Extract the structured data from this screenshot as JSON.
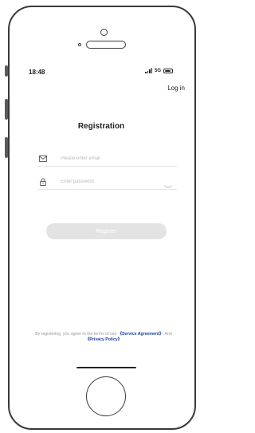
{
  "status_bar": {
    "time": "18:48",
    "network": "5G"
  },
  "header": {
    "login_label": "Log in"
  },
  "form": {
    "title": "Registration",
    "email": {
      "placeholder": "Please enter email",
      "value": "",
      "icon": "mail-icon"
    },
    "password": {
      "placeholder": "Enter password",
      "value": "",
      "icon": "lock-icon",
      "toggle_icon": "eye-closed-icon"
    },
    "register_label": "Register"
  },
  "terms": {
    "text_prefix": "By registering, you agree to the terms of use",
    "service_link": "《Service Agreement》",
    "and_text": "And",
    "privacy_link": "《Privacy Policy》"
  },
  "colors": {
    "accent_link": "#1a3fa0",
    "button_disabled": "#e3e3e3",
    "placeholder": "#b8b8b8"
  }
}
